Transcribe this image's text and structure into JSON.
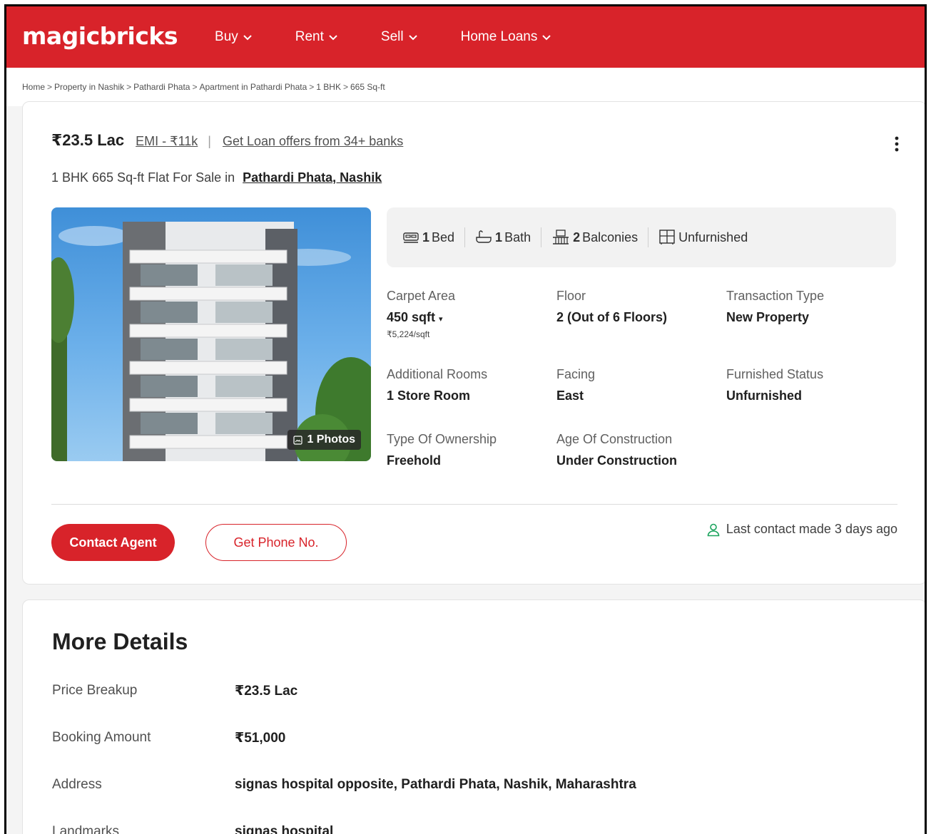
{
  "header": {
    "logo": "magicbricks",
    "nav": [
      {
        "label": "Buy"
      },
      {
        "label": "Rent"
      },
      {
        "label": "Sell"
      },
      {
        "label": "Home Loans"
      }
    ]
  },
  "breadcrumb": [
    "Home",
    "Property in Nashik",
    "Pathardi Phata",
    "Apartment in Pathardi Phata",
    "1 BHK",
    "665 Sq-ft"
  ],
  "listing": {
    "price": "₹23.5 Lac",
    "emi": "EMI - ₹11k",
    "loan_offer": "Get Loan offers from 34+ banks",
    "title_prefix": "1 BHK 665 Sq-ft Flat For Sale in",
    "location": "Pathardi Phata, Nashik",
    "photos_badge": "1 Photos",
    "amenities": {
      "bed_num": "1",
      "bed_label": "Bed",
      "bath_num": "1",
      "bath_label": "Bath",
      "balcony_num": "2",
      "balcony_label": "Balconies",
      "furnishing": "Unfurnished"
    },
    "specs": {
      "carpet_area": {
        "label": "Carpet Area",
        "value": "450 sqft",
        "sub": "₹5,224/sqft"
      },
      "floor": {
        "label": "Floor",
        "value": "2 (Out of 6 Floors)"
      },
      "transaction": {
        "label": "Transaction Type",
        "value": "New Property"
      },
      "additional_rooms": {
        "label": "Additional Rooms",
        "value": "1 Store Room"
      },
      "facing": {
        "label": "Facing",
        "value": "East"
      },
      "furnished_status": {
        "label": "Furnished Status",
        "value": "Unfurnished"
      },
      "ownership": {
        "label": "Type Of Ownership",
        "value": "Freehold"
      },
      "age": {
        "label": "Age Of Construction",
        "value": "Under Construction"
      }
    },
    "contact_button": "Contact Agent",
    "phone_button": "Get Phone No.",
    "last_contact": "Last contact made 3 days ago"
  },
  "more_details": {
    "title": "More Details",
    "rows": [
      {
        "label": "Price Breakup",
        "value": "₹23.5 Lac"
      },
      {
        "label": "Booking Amount",
        "value": "₹51,000"
      },
      {
        "label": "Address",
        "value": "signas hospital opposite, Pathardi Phata, Nashik, Maharashtra"
      },
      {
        "label": "Landmarks",
        "value": "signas hospital"
      }
    ]
  },
  "colors": {
    "brand_red": "#d8232a",
    "accent_green": "#1aa35c"
  }
}
